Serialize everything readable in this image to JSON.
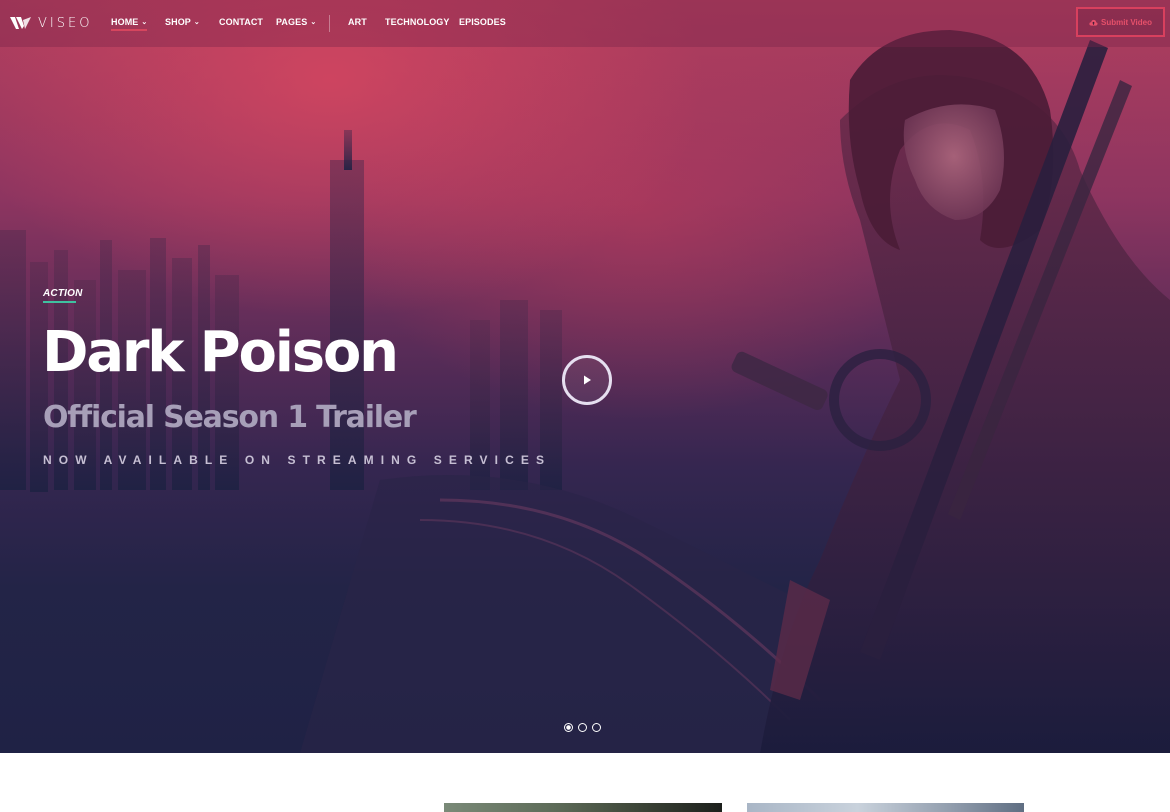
{
  "brand": {
    "name": "VISEO"
  },
  "nav": {
    "items": [
      {
        "label": "HOME",
        "chevron": true,
        "active": true
      },
      {
        "label": "SHOP",
        "chevron": true,
        "active": false
      },
      {
        "label": "CONTACT",
        "chevron": false,
        "active": false
      },
      {
        "label": "PAGES",
        "chevron": true,
        "active": false
      },
      {
        "label": "ART",
        "chevron": false,
        "active": false
      },
      {
        "label": "TECHNOLOGY",
        "chevron": false,
        "active": false
      },
      {
        "label": "EPISODES",
        "chevron": false,
        "active": false
      }
    ],
    "submit_label": "Submit Video"
  },
  "hero": {
    "category": "ACTION",
    "title": "Dark Poison",
    "subtitle": "Official Season 1 Trailer",
    "tagline": "NOW AVAILABLE ON STREAMING SERVICES",
    "slides_total": 3,
    "active_slide": 1
  },
  "colors": {
    "accent": "#d8405e",
    "category_underline": "#3fc1a0",
    "hero_top": "#b03e5e",
    "hero_bottom": "#1f2245"
  },
  "icons": {
    "logo": "viseo-logo-icon",
    "submit": "cloud-upload-icon",
    "play": "play-icon",
    "chevron": "chevron-down-icon"
  }
}
